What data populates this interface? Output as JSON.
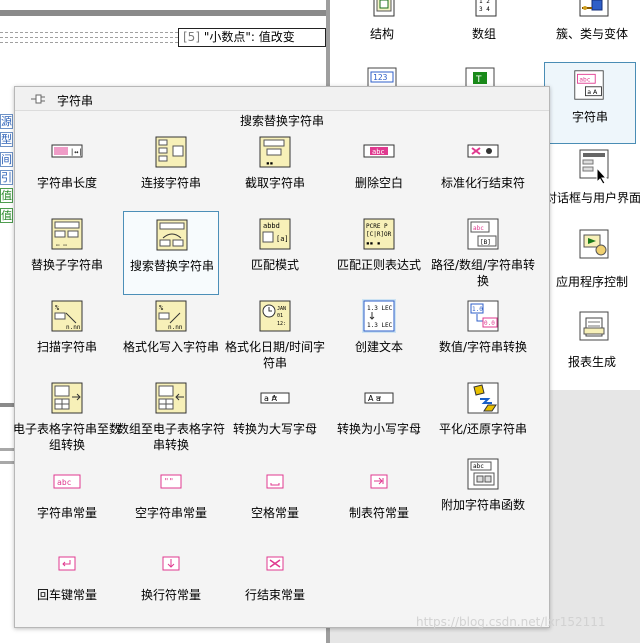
{
  "diagram": {
    "case_label_prefix": "[5]",
    "case_label_value": "\"小数点\": 值改变",
    "terminals": [
      "源",
      "型",
      "间",
      "引",
      "值",
      "值"
    ]
  },
  "palette": {
    "items": [
      {
        "name": "structure",
        "label": "结构"
      },
      {
        "name": "array",
        "label": "数组"
      },
      {
        "name": "cluster",
        "label": "簇、类与变体"
      },
      {
        "name": "numeric",
        "label": ""
      },
      {
        "name": "boolean",
        "label": ""
      },
      {
        "name": "string",
        "label": "字符串"
      },
      {
        "name": "dialog",
        "label": "对话框与用户界面"
      },
      {
        "name": "app-control",
        "label": "应用程序控制"
      },
      {
        "name": "report",
        "label": "报表生成"
      }
    ]
  },
  "sub_palette": {
    "title": "字符串",
    "hover_hint": "搜索替换字符串",
    "functions": [
      {
        "id": "string-length",
        "label": "字符串长度",
        "icon": "string-length-icon"
      },
      {
        "id": "concatenate",
        "label": "连接字符串",
        "icon": "concatenate-icon"
      },
      {
        "id": "string-subset",
        "label": "截取字符串",
        "icon": "string-subset-icon"
      },
      {
        "id": "trim-whitespace",
        "label": "删除空白",
        "icon": "trim-whitespace-icon"
      },
      {
        "id": "normalize-eol",
        "label": "标准化行结束符",
        "icon": "normalize-eol-icon"
      },
      {
        "id": "replace-substring",
        "label": "替换子字符串",
        "icon": "replace-substring-icon"
      },
      {
        "id": "search-replace",
        "label": "搜索替换字符串",
        "icon": "search-replace-icon"
      },
      {
        "id": "match-pattern",
        "label": "匹配模式",
        "icon": "match-pattern-icon"
      },
      {
        "id": "match-regex",
        "label": "匹配正则表达式",
        "icon": "match-regex-icon"
      },
      {
        "id": "path-array-string",
        "label": "路径/数组/字符串转换",
        "icon": "path-array-string-icon"
      },
      {
        "id": "scan-from-string",
        "label": "扫描字符串",
        "icon": "scan-string-icon"
      },
      {
        "id": "format-into-string",
        "label": "格式化写入字符串",
        "icon": "format-into-string-icon"
      },
      {
        "id": "format-datetime",
        "label": "格式化日期/时间字符串",
        "icon": "format-datetime-icon"
      },
      {
        "id": "build-text",
        "label": "创建文本",
        "icon": "build-text-icon"
      },
      {
        "id": "number-string",
        "label": "数值/字符串转换",
        "icon": "number-string-icon"
      },
      {
        "id": "spreadsheet-to-array",
        "label": "电子表格字符串至数组转换",
        "icon": "spreadsheet-to-array-icon"
      },
      {
        "id": "array-to-spreadsheet",
        "label": "数组至电子表格字符串转换",
        "icon": "array-to-spreadsheet-icon"
      },
      {
        "id": "to-upper",
        "label": "转换为大写字母",
        "icon": "to-upper-icon"
      },
      {
        "id": "to-lower",
        "label": "转换为小写字母",
        "icon": "to-lower-icon"
      },
      {
        "id": "flatten",
        "label": "平化/还原字符串",
        "icon": "flatten-icon"
      },
      {
        "id": "string-constant",
        "label": "字符串常量",
        "icon": "string-constant-icon"
      },
      {
        "id": "empty-string",
        "label": "空字符串常量",
        "icon": "empty-string-icon"
      },
      {
        "id": "space-constant",
        "label": "空格常量",
        "icon": "space-constant-icon"
      },
      {
        "id": "tab-constant",
        "label": "制表符常量",
        "icon": "tab-constant-icon"
      },
      {
        "id": "additional-string",
        "label": "附加字符串函数",
        "icon": "additional-string-icon"
      },
      {
        "id": "cr-constant",
        "label": "回车键常量",
        "icon": "cr-constant-icon"
      },
      {
        "id": "lf-constant",
        "label": "换行符常量",
        "icon": "lf-constant-icon"
      },
      {
        "id": "eol-constant",
        "label": "行结束常量",
        "icon": "eol-constant-icon"
      }
    ]
  },
  "watermark": "https://blog.csdn.net/lxr152111",
  "colors": {
    "string_pink": "#e0398f",
    "selection_border": "#4c8fb8",
    "icon_cream": "#f7f0b8"
  }
}
